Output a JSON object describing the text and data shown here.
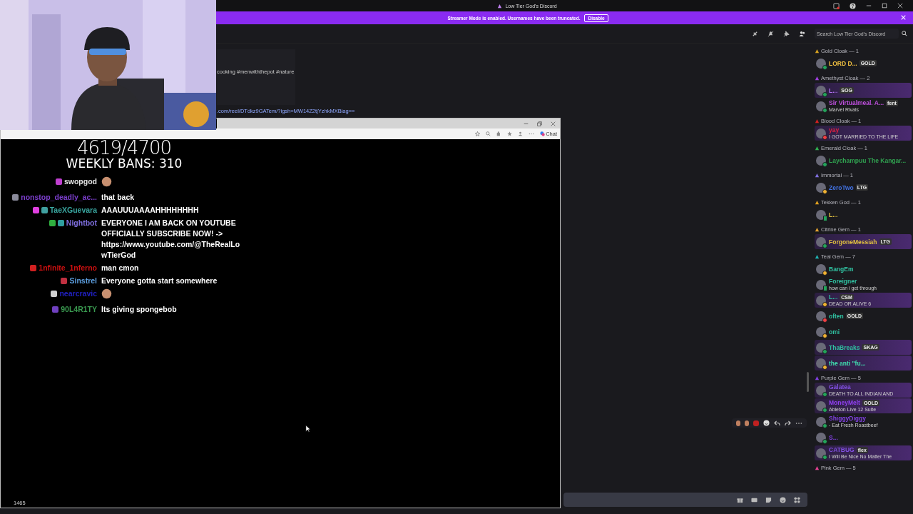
{
  "window": {
    "title": "Low Tier God's Discord"
  },
  "banner": {
    "text": "Streamer Mode is enabled. Usernames have been truncated.",
    "button": "Disable"
  },
  "header": {
    "search": {
      "placeholder": "Search Low Tier God's Discord"
    }
  },
  "messages": {
    "embed_text": "cooking #menwiththepot #nature",
    "link": ".com/reel/DTdkz9GATem/?igsh=MW14Z2tjYzhkMXBiag=="
  },
  "browser": {
    "chat_button": "Chat",
    "counter": "4619/4700",
    "weekly_bans": "WEEKLY BANS: 310",
    "footer_count": "1465",
    "chat": [
      {
        "kind": "emote",
        "name": "swopgod",
        "color": "#e6e6e6",
        "badges": [
          {
            "color": "#c040d0"
          }
        ]
      },
      {
        "kind": "text",
        "name": "nonstop_deadly_ac...",
        "color": "#7d3fcf",
        "badges": [
          {
            "color": "#8a8a9a"
          }
        ],
        "message": "that back"
      },
      {
        "kind": "text",
        "name": "TaeXGuevara",
        "color": "#3aa7a0",
        "badges": [
          {
            "color": "#e040e0"
          },
          {
            "color": "#40a0a0"
          }
        ],
        "message": "AAAUUUAAAAHHHHHHHH"
      },
      {
        "kind": "text",
        "name": "Nightbot",
        "color": "#7f6fe0",
        "badges": [
          {
            "color": "#30b040"
          },
          {
            "color": "#30a0a0"
          }
        ],
        "message": "EVERYONE I AM BACK ON YOUTUBE OFFICIALLY SUBSCRIBE NOW! -> https://www.youtube.com/@TheRealLowTierGod"
      },
      {
        "kind": "text",
        "name": "1nfinite_1nferno",
        "color": "#d01010",
        "badges": [
          {
            "color": "#d02020"
          }
        ],
        "message": "man cmon"
      },
      {
        "kind": "text",
        "name": "Sinstrel",
        "color": "#5d9fe0",
        "badges": [
          {
            "color": "#c03040"
          }
        ],
        "message": "Everyone gotta start somewhere"
      },
      {
        "kind": "emote",
        "name": "nearcravic",
        "color": "#2020c0",
        "badges": [
          {
            "color": "#d0d0d0"
          }
        ]
      },
      {
        "kind": "text",
        "name": "90L4R1TY",
        "color": "#3a9a50",
        "badges": [
          {
            "color": "#7040c0"
          }
        ],
        "message": "Its giving spongebob"
      }
    ]
  },
  "members": [
    {
      "title": "Gold Cloak — 1",
      "color": "#d4a020",
      "members": [
        {
          "kind": "online",
          "name": "LORD D...",
          "color": "#f0c040",
          "badge": "GOLD",
          "highlighted": false
        }
      ]
    },
    {
      "title": "Amethyst Cloak — 2",
      "color": "#a040e0",
      "members": [
        {
          "kind": "online",
          "name": "L...",
          "color": "#b070f0",
          "badge": "SOG",
          "highlighted": true
        },
        {
          "kind": "online",
          "name": "Sir Virtualmeal. A...",
          "color": "#c050e0",
          "badge": "fent",
          "status": "Marvel Rivals",
          "highlighted": false
        }
      ]
    },
    {
      "title": "Blood Cloak — 1",
      "color": "#d02020",
      "members": [
        {
          "kind": "dnd",
          "name": "yay",
          "color": "#e02040",
          "status": "I GOT MARRIED TO THE LIFE",
          "highlighted": true
        }
      ]
    },
    {
      "title": "Emerald Cloak — 1",
      "color": "#30b050",
      "members": [
        {
          "kind": "online",
          "name": "Laychampuu The Kangar...",
          "color": "#30a050",
          "highlighted": false
        }
      ]
    },
    {
      "title": "Immortal — 1",
      "color": "#8070e0",
      "members": [
        {
          "kind": "idle",
          "name": "ZeroTwo",
          "color": "#4070e0",
          "badge": "LTG",
          "highlighted": false
        }
      ]
    },
    {
      "title": "Tekken God — 1",
      "color": "#e0a020",
      "members": [
        {
          "kind": "mobile",
          "name": "L...",
          "color": "#e0c040",
          "highlighted": false
        }
      ]
    },
    {
      "title": "Citrine Gem — 1",
      "color": "#e0a030",
      "members": [
        {
          "kind": "online",
          "name": "ForgoneMessiah",
          "color": "#e0c040",
          "badge": "LTG",
          "highlighted": true
        }
      ]
    },
    {
      "title": "Teal Gem — 7",
      "color": "#20b0b0",
      "members": [
        {
          "kind": "idle",
          "name": "BangEm",
          "color": "#30c0a0",
          "highlighted": false
        },
        {
          "kind": "mobile",
          "name": "Foreigner",
          "color": "#30c0a0",
          "status": "how can i get through",
          "highlighted": false
        },
        {
          "kind": "idle",
          "name": "L...",
          "color": "#30c0a0",
          "badge": "CSM",
          "status": "DEAD OR ALIVE 6",
          "highlighted": true
        },
        {
          "kind": "dnd",
          "name": "often",
          "color": "#30c0a0",
          "badge": "GOLD",
          "highlighted": false
        },
        {
          "kind": "idle",
          "name": "omi",
          "color": "#30c0a0",
          "highlighted": false
        },
        {
          "kind": "online",
          "name": "ThaBreaks",
          "color": "#30c0a0",
          "badge": "SKAG",
          "highlighted": true
        },
        {
          "kind": "idle",
          "name": "the anti \"fu...",
          "color": "#40e0b0",
          "highlighted": true
        }
      ]
    },
    {
      "title": "Purple Gem — 5",
      "color": "#8040e0",
      "members": [
        {
          "kind": "online",
          "name": "Galatea",
          "color": "#8050e0",
          "status": "DEATH TO ALL INDIAN AND",
          "highlighted": true
        },
        {
          "kind": "online",
          "name": "MoneyMelt",
          "color": "#9040f0",
          "badge": "GOLD",
          "status": "Ableton Live 12 Suite",
          "highlighted": true
        },
        {
          "kind": "online",
          "name": "ShiggyDiggy",
          "color": "#8040e0",
          "status": "- Eat Fresh Roastbeef",
          "highlighted": false
        },
        {
          "kind": "online",
          "name": "S...",
          "color": "#8040e0",
          "highlighted": false
        },
        {
          "kind": "online",
          "name": "CATBUG",
          "color": "#8050e0",
          "badge": "flex",
          "status": "I Will Be Nice No Matter The",
          "highlighted": true
        }
      ]
    },
    {
      "title": "Pink Gem — 5",
      "color": "#e04090"
    }
  ]
}
